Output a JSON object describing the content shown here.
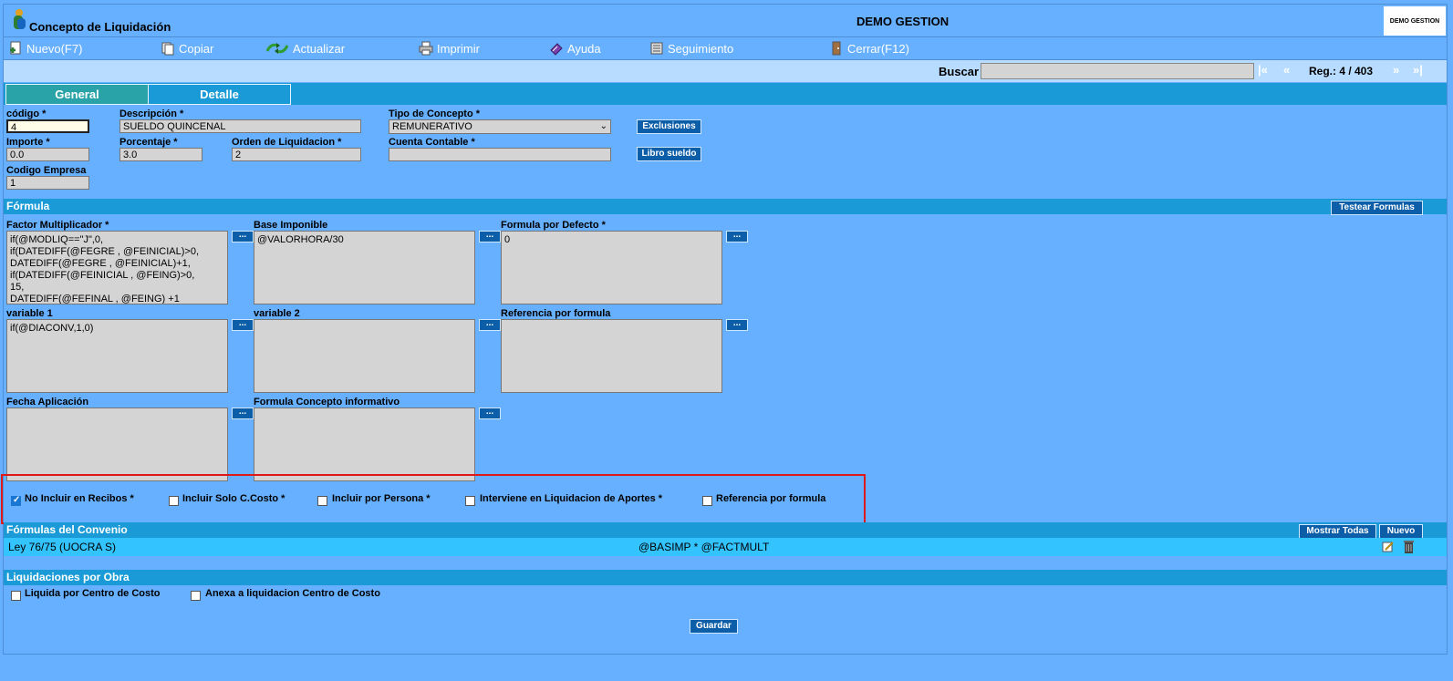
{
  "app": {
    "title": "Concepto de Liquidación",
    "company": "DEMO GESTION",
    "brand": "DEMO GESTION"
  },
  "toolbar": {
    "nuevo": "Nuevo(F7)",
    "copiar": "Copiar",
    "actualizar": "Actualizar",
    "imprimir": "Imprimir",
    "ayuda": "Ayuda",
    "seguimiento": "Seguimiento",
    "cerrar": "Cerrar(F12)"
  },
  "search": {
    "label": "Buscar",
    "value": "",
    "first": "|«",
    "prev": "«",
    "record": "Reg.: 4 / 403",
    "next": "»",
    "last": "»|"
  },
  "tabs": {
    "general": "General",
    "detalle": "Detalle"
  },
  "fields": {
    "codigo_label": "código *",
    "codigo_value": "4",
    "descripcion_label": "Descripción *",
    "descripcion_value": "SUELDO QUINCENAL",
    "tipo_label": "Tipo de Concepto *",
    "tipo_value": "REMUNERATIVO",
    "importe_label": "Importe *",
    "importe_value": "0.0",
    "porcentaje_label": "Porcentaje *",
    "porcentaje_value": "3.0",
    "orden_label": "Orden de Liquidacion *",
    "orden_value": "2",
    "cuenta_label": "Cuenta Contable *",
    "cuenta_value": "",
    "empresa_label": "Codigo Empresa",
    "empresa_value": "1",
    "exclusiones": "Exclusiones",
    "libro": "Libro sueldo"
  },
  "formula": {
    "section": "Fórmula",
    "testear": "Testear Formulas",
    "dots": "...",
    "factor_label": "Factor Multiplicador *",
    "factor_value": "if(@MODLIQ==\"J\",0,\nif(DATEDIFF(@FEGRE , @FEINICIAL)>0,\nDATEDIFF(@FEGRE , @FEINICIAL)+1,\nif(DATEDIFF(@FEINICIAL , @FEING)>0,\n15,\nDATEDIFF(@FEFINAL , @FEING) +1",
    "base_label": "Base Imponible",
    "base_value": "@VALORHORA/30",
    "defecto_label": "Formula por Defecto *",
    "defecto_value": "0",
    "var1_label": "variable 1",
    "var1_value": "if(@DIACONV,1,0)",
    "var2_label": "variable 2",
    "var2_value": "",
    "ref_label": "Referencia por formula",
    "ref_value": "",
    "fecha_label": "Fecha Aplicación",
    "fecha_value": "",
    "informativo_label": "Formula Concepto informativo",
    "informativo_value": ""
  },
  "checks": {
    "no_incluir": "No Incluir en Recibos *",
    "solo_costo": "Incluir Solo C.Costo *",
    "por_persona": "Incluir por Persona *",
    "aportes": "Interviene en Liquidacion de Aportes *",
    "referencia": "Referencia por formula"
  },
  "convenio": {
    "section": "Fórmulas del Convenio",
    "mostrar": "Mostrar Todas",
    "nuevo": "Nuevo",
    "rows": [
      {
        "name": "Ley 76/75 (UOCRA S)",
        "formula": "@BASIMP * @FACTMULT"
      }
    ]
  },
  "obra": {
    "section": "Liquidaciones por Obra",
    "centro": "Liquida por Centro de Costo",
    "anexa": "Anexa a liquidacion Centro de Costo"
  },
  "guardar": "Guardar",
  "colors": {
    "bg": "#66b0ff",
    "section": "#1a9bd7",
    "button": "#0d5ea8",
    "highlight": "#e01818"
  }
}
